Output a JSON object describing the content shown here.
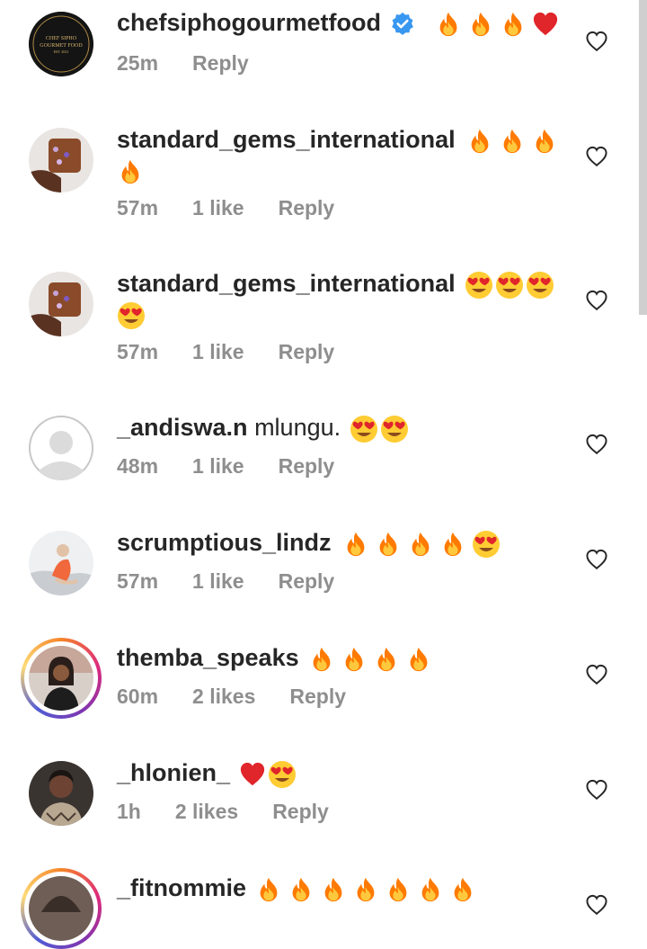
{
  "colors": {
    "username": "#262626",
    "meta": "#8e8e8e",
    "verified": "#3897f0",
    "red_heart": "#e0252b",
    "fire": "#ff7a00"
  },
  "comments": [
    {
      "username": "chefsiphogourmetfood",
      "verified": true,
      "text": "",
      "emojis": [
        "fire",
        "fire",
        "fire",
        "red-heart"
      ],
      "time": "25m",
      "likes": "",
      "reply": "Reply",
      "avatar_text": [
        "CHEF SIPHO",
        "GOURMET FOOD",
        "EST. 2021"
      ]
    },
    {
      "username": "standard_gems_international",
      "text": "",
      "emojis": [
        "fire",
        "fire",
        "fire",
        "fire"
      ],
      "time": "57m",
      "likes": "1 like",
      "reply": "Reply"
    },
    {
      "username": "standard_gems_international",
      "text": "",
      "emojis": [
        "heart-eyes",
        "heart-eyes",
        "heart-eyes",
        "heart-eyes"
      ],
      "time": "57m",
      "likes": "1 like",
      "reply": "Reply"
    },
    {
      "username": "_andiswa.n",
      "text": "mlungu.",
      "emojis": [
        "heart-eyes",
        "heart-eyes"
      ],
      "time": "48m",
      "likes": "1 like",
      "reply": "Reply"
    },
    {
      "username": "scrumptious_lindz",
      "text": "",
      "emojis": [
        "fire",
        "fire",
        "fire",
        "fire",
        "heart-eyes"
      ],
      "time": "57m",
      "likes": "1 like",
      "reply": "Reply"
    },
    {
      "username": "themba_speaks",
      "text": "",
      "emojis": [
        "fire",
        "fire",
        "fire",
        "fire"
      ],
      "time": "60m",
      "likes": "2 likes",
      "reply": "Reply"
    },
    {
      "username": "_hlonien_",
      "text": "",
      "emojis": [
        "red-heart",
        "heart-eyes"
      ],
      "time": "1h",
      "likes": "2 likes",
      "reply": "Reply"
    },
    {
      "username": "_fitnommie",
      "text": "",
      "emojis": [
        "fire",
        "fire",
        "fire",
        "fire",
        "fire",
        "fire",
        "fire"
      ],
      "time": "",
      "likes": "",
      "reply": ""
    }
  ]
}
